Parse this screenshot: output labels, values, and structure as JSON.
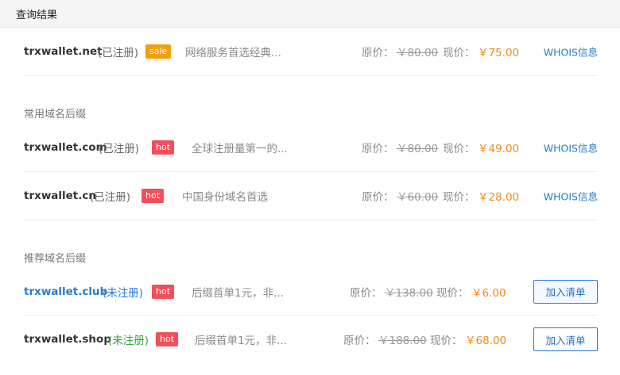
{
  "header": {
    "title": "查询结果"
  },
  "labels": {
    "orig": "原价：",
    "now": "现价：",
    "whois": "WHOIS信息",
    "add": "加入清单"
  },
  "sections": {
    "common": "常用域名后缀",
    "recommended": "推荐域名后缀"
  },
  "rows": [
    {
      "domain": "trxwallet.net",
      "status": "(已注册)",
      "badge": "sale",
      "desc": "网络服务首选经典...",
      "orig": "￥80.00",
      "now": "￥75.00"
    },
    {
      "domain": "trxwallet.com",
      "status": "(已注册)",
      "badge": "hot",
      "desc": "全球注册量第一的...",
      "orig": "￥80.00",
      "now": "￥49.00"
    },
    {
      "domain": "trxwallet.cn",
      "status": "(已注册)",
      "badge": "hot",
      "desc": "中国身份域名首选",
      "orig": "￥60.00",
      "now": "￥28.00"
    },
    {
      "domain": "trxwallet.club",
      "status": "(未注册)",
      "badge": "hot",
      "desc": "后缀首单1元，非...",
      "orig": "￥138.00",
      "now": "￥6.00"
    },
    {
      "domain": "trxwallet.shop",
      "status": "(未注册)",
      "badge": "hot",
      "desc": "后缀首单1元，非...",
      "orig": "￥188.00",
      "now": "￥68.00"
    }
  ],
  "colors": {
    "sale": "#f0a00c",
    "hot": "#f24f5c",
    "price": "#f08a17",
    "link": "#2a7ad0",
    "available_green": "#3aa13a"
  }
}
